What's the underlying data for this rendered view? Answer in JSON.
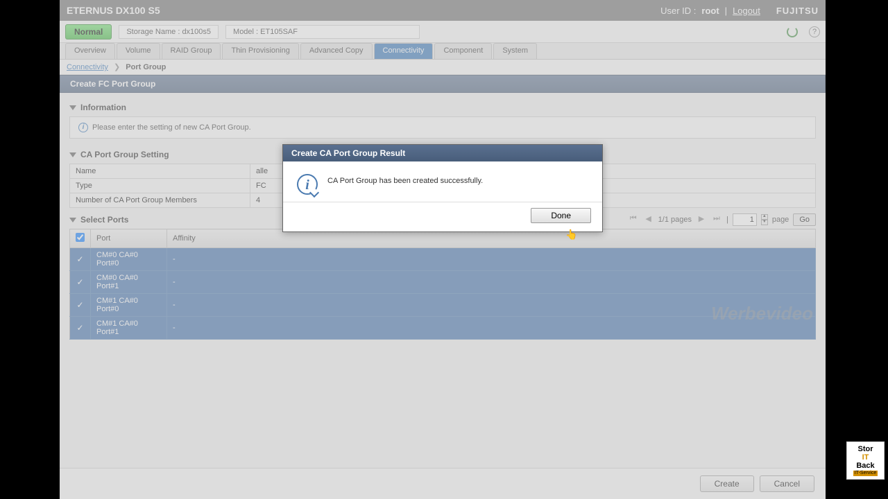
{
  "header": {
    "product": "ETERNUS DX100 S5",
    "user_label": "User ID :",
    "user_id": "root",
    "logout": "Logout",
    "brand": "FUJITSU"
  },
  "status": {
    "state": "Normal",
    "storage_label": "Storage Name : dx100s5",
    "model_label": "Model : ET105SAF"
  },
  "tabs": [
    "Overview",
    "Volume",
    "RAID Group",
    "Thin Provisioning",
    "Advanced Copy",
    "Connectivity",
    "Component",
    "System"
  ],
  "active_tab": "Connectivity",
  "breadcrumb": {
    "root": "Connectivity",
    "sep": "❯",
    "current": "Port Group"
  },
  "page_title": "Create FC Port Group",
  "info_section": {
    "title": "Information",
    "message": "Please enter the setting of new CA Port Group."
  },
  "setting_section": {
    "title": "CA Port Group Setting",
    "rows": [
      {
        "label": "Name",
        "value": "alle"
      },
      {
        "label": "Type",
        "value": "FC"
      },
      {
        "label": "Number of CA Port Group Members",
        "value": "4"
      }
    ]
  },
  "ports_section": {
    "title": "Select Ports",
    "pager": {
      "pages": "1/1 pages",
      "page_value": "1",
      "page_label": "page",
      "go": "Go"
    },
    "columns": [
      "Port",
      "Affinity"
    ],
    "rows": [
      {
        "port": "CM#0 CA#0 Port#0",
        "affinity": "-"
      },
      {
        "port": "CM#0 CA#0 Port#1",
        "affinity": "-"
      },
      {
        "port": "CM#1 CA#0 Port#0",
        "affinity": "-"
      },
      {
        "port": "CM#1 CA#0 Port#1",
        "affinity": "-"
      }
    ]
  },
  "modal": {
    "title": "Create CA Port Group Result",
    "message": "CA Port Group has been created successfully.",
    "done": "Done"
  },
  "actions": {
    "create": "Create",
    "cancel": "Cancel"
  },
  "watermark": "Werbevideo",
  "logo_badge": {
    "l1": "Stor",
    "l2": "IT",
    "l3": "Back",
    "l4": "IT-Service"
  }
}
